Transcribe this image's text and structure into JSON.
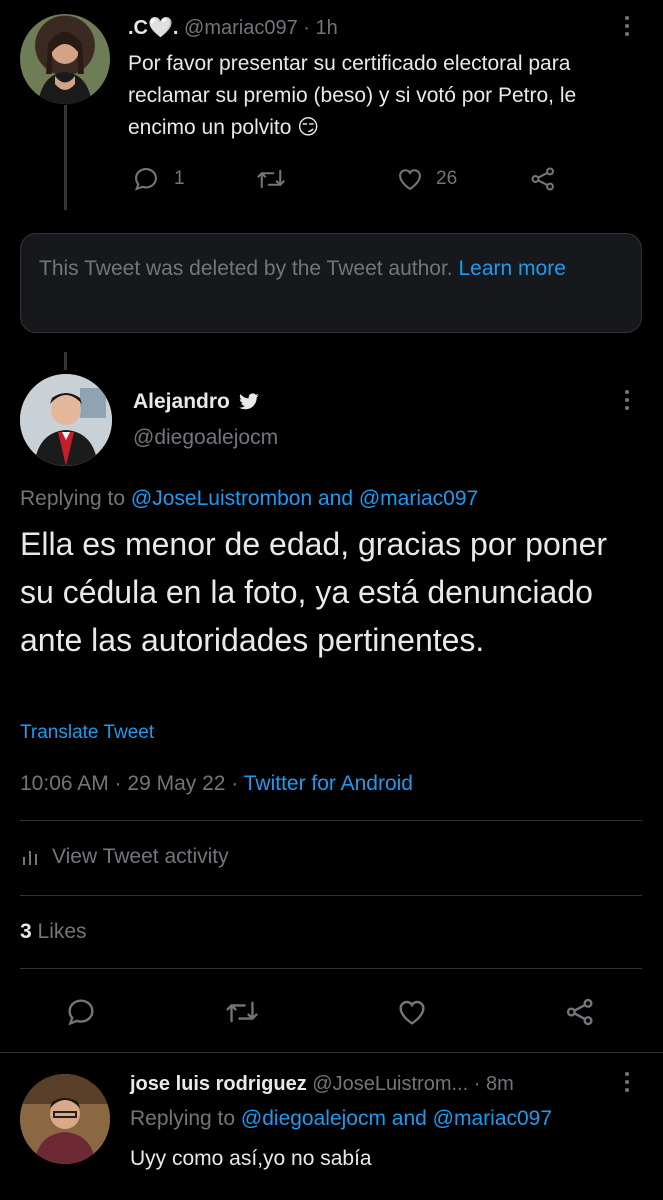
{
  "tweet1": {
    "display_name": ".C🤍.",
    "handle": "@mariac097",
    "time": "· 1h",
    "text": "Por favor presentar su certificado electoral para reclamar su premio (beso) y si votó por Petro, le encimo un polvito 😏",
    "reply_count": "1",
    "retweet_count": "",
    "like_count": "26"
  },
  "deleted_notice": {
    "text": "This Tweet was deleted by the Tweet author.",
    "link": "Learn more"
  },
  "main_tweet": {
    "display_name": "Alejandro",
    "handle": "@diegoalejocm",
    "replying_prefix": "Replying to ",
    "replying_to": "@JoseLuistrombon and @mariac097",
    "text": "Ella es menor de edad, gracias por poner su cédula en la foto, ya está denunciado ante las autoridades pertinentes.",
    "translate": "Translate Tweet",
    "time": "10:06 AM · 29 May 22 · ",
    "client": "Twitter for Android",
    "activity": "View Tweet activity",
    "likes_count": "3",
    "likes_label": " Likes"
  },
  "reply": {
    "display_name": "jose luis rodriguez",
    "handle": "@JoseLuistrom...",
    "time": "· 8m",
    "replying_prefix": "Replying to ",
    "replying_to": "@diegoalejocm and @mariac097",
    "text": "Uyy como así,yo no sabía"
  },
  "colors": {
    "background": "#000000",
    "text": "#e7e9ea",
    "muted": "#71767b",
    "accent": "#1d9bf0",
    "border": "#2f3336"
  },
  "icons": [
    "reply-icon",
    "retweet-icon",
    "like-icon",
    "share-icon",
    "verified-icon",
    "more-icon",
    "bar-chart-icon"
  ]
}
